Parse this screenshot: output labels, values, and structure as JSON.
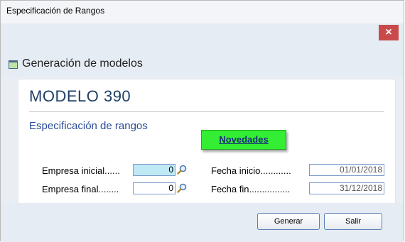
{
  "window": {
    "title": "Especificación de Rangos",
    "close_glyph": "×"
  },
  "header": {
    "icon": "window-icon",
    "text": "Generación de modelos"
  },
  "main": {
    "model_title": "MODELO 390",
    "subtitle": "Especificación de rangos",
    "novedades_label": "Novedades"
  },
  "form": {
    "empresa_inicial_label": "Empresa inicial......",
    "empresa_inicial_value": "0",
    "empresa_final_label": "Empresa final........",
    "empresa_final_value": "0",
    "fecha_inicio_label": "Fecha inicio............",
    "fecha_inicio_value": "01/01/2018",
    "fecha_fin_label": "Fecha fin................",
    "fecha_fin_value": "31/12/2018"
  },
  "buttons": {
    "generar": "Generar",
    "salir": "Salir"
  },
  "colors": {
    "close": "#c94a4a",
    "novedades_bg": "#33ee33",
    "title": "#1f3f66",
    "subtitle": "#2b4a9a"
  }
}
